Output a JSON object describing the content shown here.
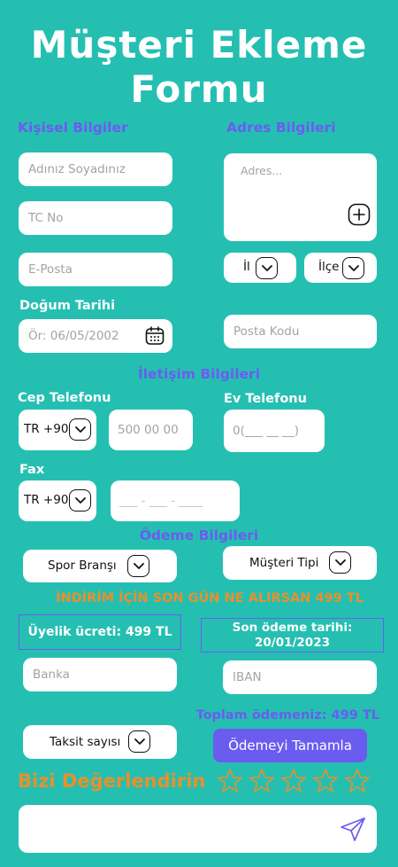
{
  "title": {
    "line1": "Müşteri Ekleme",
    "line2": "Formu"
  },
  "sections": {
    "personal": "Kişisel Bilgiler",
    "address": "Adres Bilgileri",
    "contact": "İletişim Bilgileri",
    "payment": "Ödeme Bilgileri"
  },
  "personal": {
    "name_placeholder": "Adınız Soyadınız",
    "tc_placeholder": "TC No",
    "email_placeholder": "E-Posta",
    "birth_label": "Doğum Tarihi",
    "birth_placeholder": "Ör: 06/05/2002"
  },
  "address": {
    "address_placeholder": "Adres...",
    "il_label": "İl",
    "ilce_label": "İlçe",
    "postal_placeholder": "Posta Kodu"
  },
  "contact": {
    "mobile_label": "Cep Telefonu",
    "mobile_code": "TR +90",
    "mobile_placeholder": "500 00 00",
    "home_label": "Ev Telefonu",
    "home_placeholder": "0(___ __ __)",
    "fax_label": "Fax",
    "fax_code": "TR +90",
    "fax_placeholder": "___ - ___ - ____"
  },
  "payment": {
    "sport_label": "Spor Branşı",
    "customer_type_label": "Müşteri Tipi",
    "promo": "İNDİRİM İÇİN SON GÜN NE ALIRSAN 499 TL",
    "membership_fee": "Üyelik ücreti: 499 TL",
    "due_date_line1": "Son ödeme tarihi:",
    "due_date_line2": "20/01/2023",
    "bank_placeholder": "Banka",
    "iban_placeholder": "IBAN",
    "total": "Toplam ödemeniz: 499 TL",
    "installment_label": "Taksit sayısı",
    "complete_button": "Ödemeyi Tamamla"
  },
  "rating": {
    "label": "Bizi Değerlendirin",
    "stars_max": 5,
    "stars_filled": 0
  },
  "colors": {
    "background": "#25bfb2",
    "section_heading": "#6b5cf0",
    "accent_orange": "#e8902b",
    "button": "#6b5cf0"
  }
}
